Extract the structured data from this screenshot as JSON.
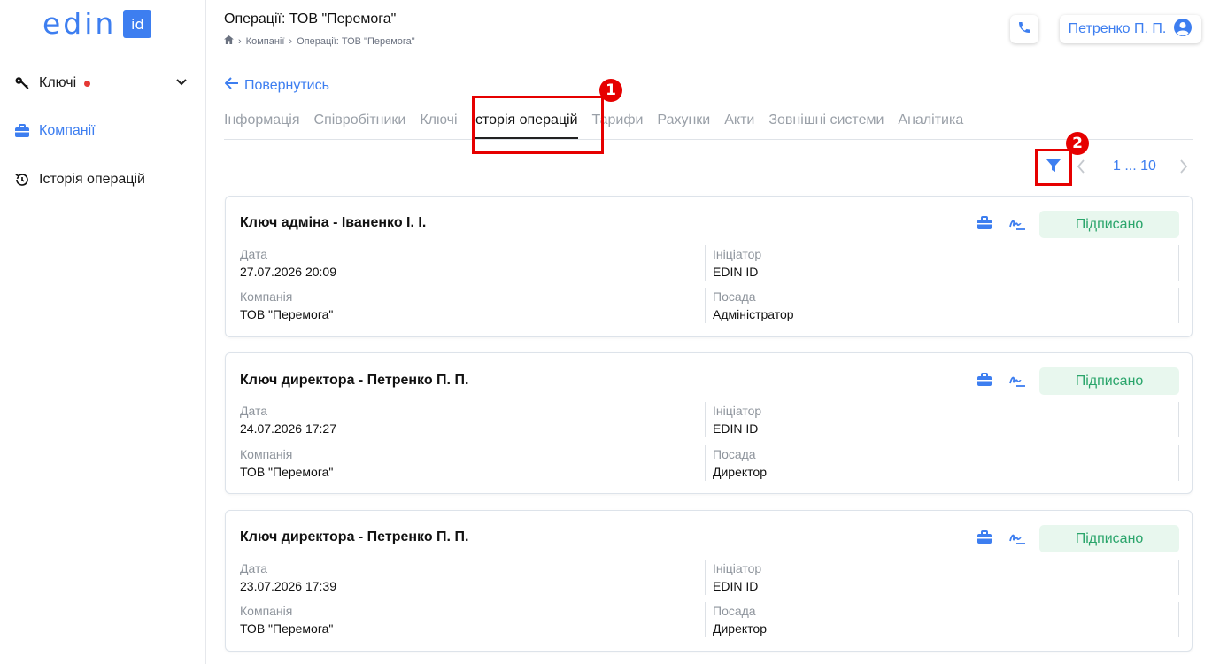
{
  "app": {
    "logo_text": "edin",
    "logo_badge": "id"
  },
  "sidebar": {
    "items": [
      {
        "label": "Ключі",
        "icon": "key-icon",
        "has_alert": true,
        "expandable": true
      },
      {
        "label": "Компанії",
        "icon": "briefcase-icon",
        "active": true
      },
      {
        "label": "Історія операцій",
        "icon": "history-icon"
      }
    ]
  },
  "header": {
    "title": "Операції: ТОВ \"Перемога\"",
    "breadcrumb": [
      "Компанії",
      "Операції: ТОВ \"Перемога\""
    ],
    "user_name": "Петренко П. П."
  },
  "content": {
    "back_label": "Повернутись",
    "tabs": [
      "Інформація",
      "Співробітники",
      "Ключі",
      "Історія операцій",
      "Тарифи",
      "Рахунки",
      "Акти",
      "Зовнішні системи",
      "Аналітика"
    ],
    "active_tab": 3,
    "annotations": [
      "1",
      "2"
    ],
    "pager": {
      "range": "1 ... 10"
    },
    "labels": {
      "date": "Дата",
      "initiator": "Ініціатор",
      "company": "Компанія",
      "position": "Посада"
    },
    "cards": [
      {
        "title": "Ключ адміна - Іваненко І. І.",
        "status": "Підписано",
        "date": "27.07.2026 20:09",
        "initiator": "EDIN ID",
        "company": "ТОВ \"Перемога\"",
        "position": "Адміністратор"
      },
      {
        "title": "Ключ директора - Петренко П. П.",
        "status": "Підписано",
        "date": "24.07.2026 17:27",
        "initiator": "EDIN ID",
        "company": "ТОВ \"Перемога\"",
        "position": "Директор"
      },
      {
        "title": "Ключ директора - Петренко П. П.",
        "status": "Підписано",
        "date": "23.07.2026 17:39",
        "initiator": "EDIN ID",
        "company": "ТОВ \"Перемога\"",
        "position": "Директор"
      }
    ]
  },
  "colors": {
    "accent": "#3d7ef0",
    "status_bg": "#e8f7ee",
    "status_text": "#2aa56b",
    "annotation": "#e60000"
  }
}
